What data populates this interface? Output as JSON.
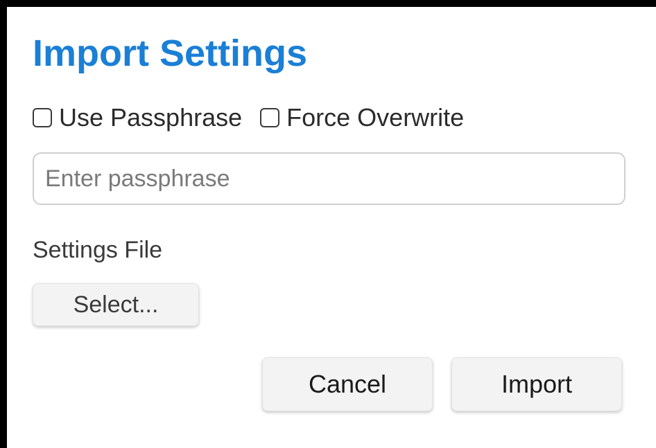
{
  "dialog": {
    "title": "Import Settings",
    "title_color": "#1a7fd6"
  },
  "options": {
    "use_passphrase": {
      "label": "Use Passphrase",
      "checked": false
    },
    "force_overwrite": {
      "label": "Force Overwrite",
      "checked": false
    }
  },
  "passphrase": {
    "placeholder": "Enter passphrase",
    "value": ""
  },
  "settings_file": {
    "label": "Settings File",
    "select_label": "Select..."
  },
  "actions": {
    "cancel_label": "Cancel",
    "import_label": "Import"
  }
}
